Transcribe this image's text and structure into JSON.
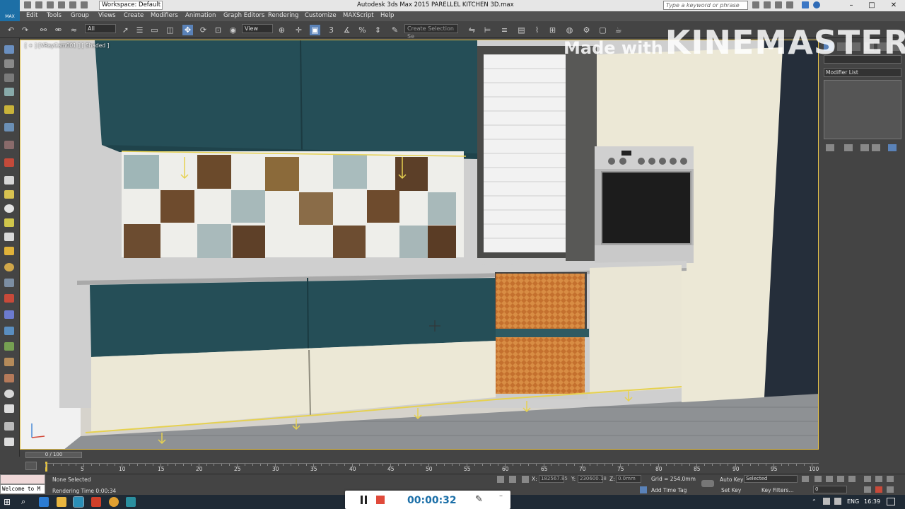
{
  "titlebar": {
    "workspace": "Workspace: Default",
    "title": "Autodesk 3ds Max 2015     PARELLEL KITCHEN 3D.max",
    "search_placeholder": "Type a keyword or phrase"
  },
  "app_logo": "MAX",
  "menu": [
    "Edit",
    "Tools",
    "Group",
    "Views",
    "Create",
    "Modifiers",
    "Animation",
    "Graph Editors",
    "Rendering",
    "Customize",
    "MAXScript",
    "Help"
  ],
  "toolbar": {
    "filter_value": "All",
    "reference_coord": "View",
    "selection_set_placeholder": "Create Selection Se"
  },
  "viewport": {
    "label": "[ + ] [VRayCam001 ] [ Shaded ]",
    "dominant_color": "#d8d8d8"
  },
  "watermark": {
    "small": "Made with",
    "big": "KINEMASTER"
  },
  "command_panel": {
    "modifier_list": "Modifier List"
  },
  "timeline": {
    "slider_label": "0 / 100",
    "ticks": [
      "5",
      "10",
      "15",
      "20",
      "25",
      "30",
      "35",
      "40",
      "45",
      "50",
      "55",
      "60",
      "65",
      "70",
      "75",
      "80",
      "85",
      "90",
      "95",
      "100"
    ]
  },
  "status": {
    "selection": "None Selected",
    "maxscript": "Welcome to M",
    "render_time": "Rendering Time  0:00:34",
    "x_value": "182567.85",
    "y_value": "230600.18",
    "z_value": "0.0mm",
    "grid": "Grid = 254.0mm",
    "add_time_tag": "Add Time Tag",
    "auto_key": "Auto Key",
    "set_key": "Set Key",
    "key_mode": "Selected",
    "key_filters": "Key Filters...",
    "frame": "0"
  },
  "recorder": {
    "time": "00:00:32"
  },
  "tray": {
    "language": "ENG",
    "clock": "16:39"
  },
  "colors": {
    "teal_cabinet": "#254e57",
    "cream_cabinet": "#ece8d6",
    "wicker": "#c4702e",
    "accent_blue": "#1b6fa8"
  }
}
